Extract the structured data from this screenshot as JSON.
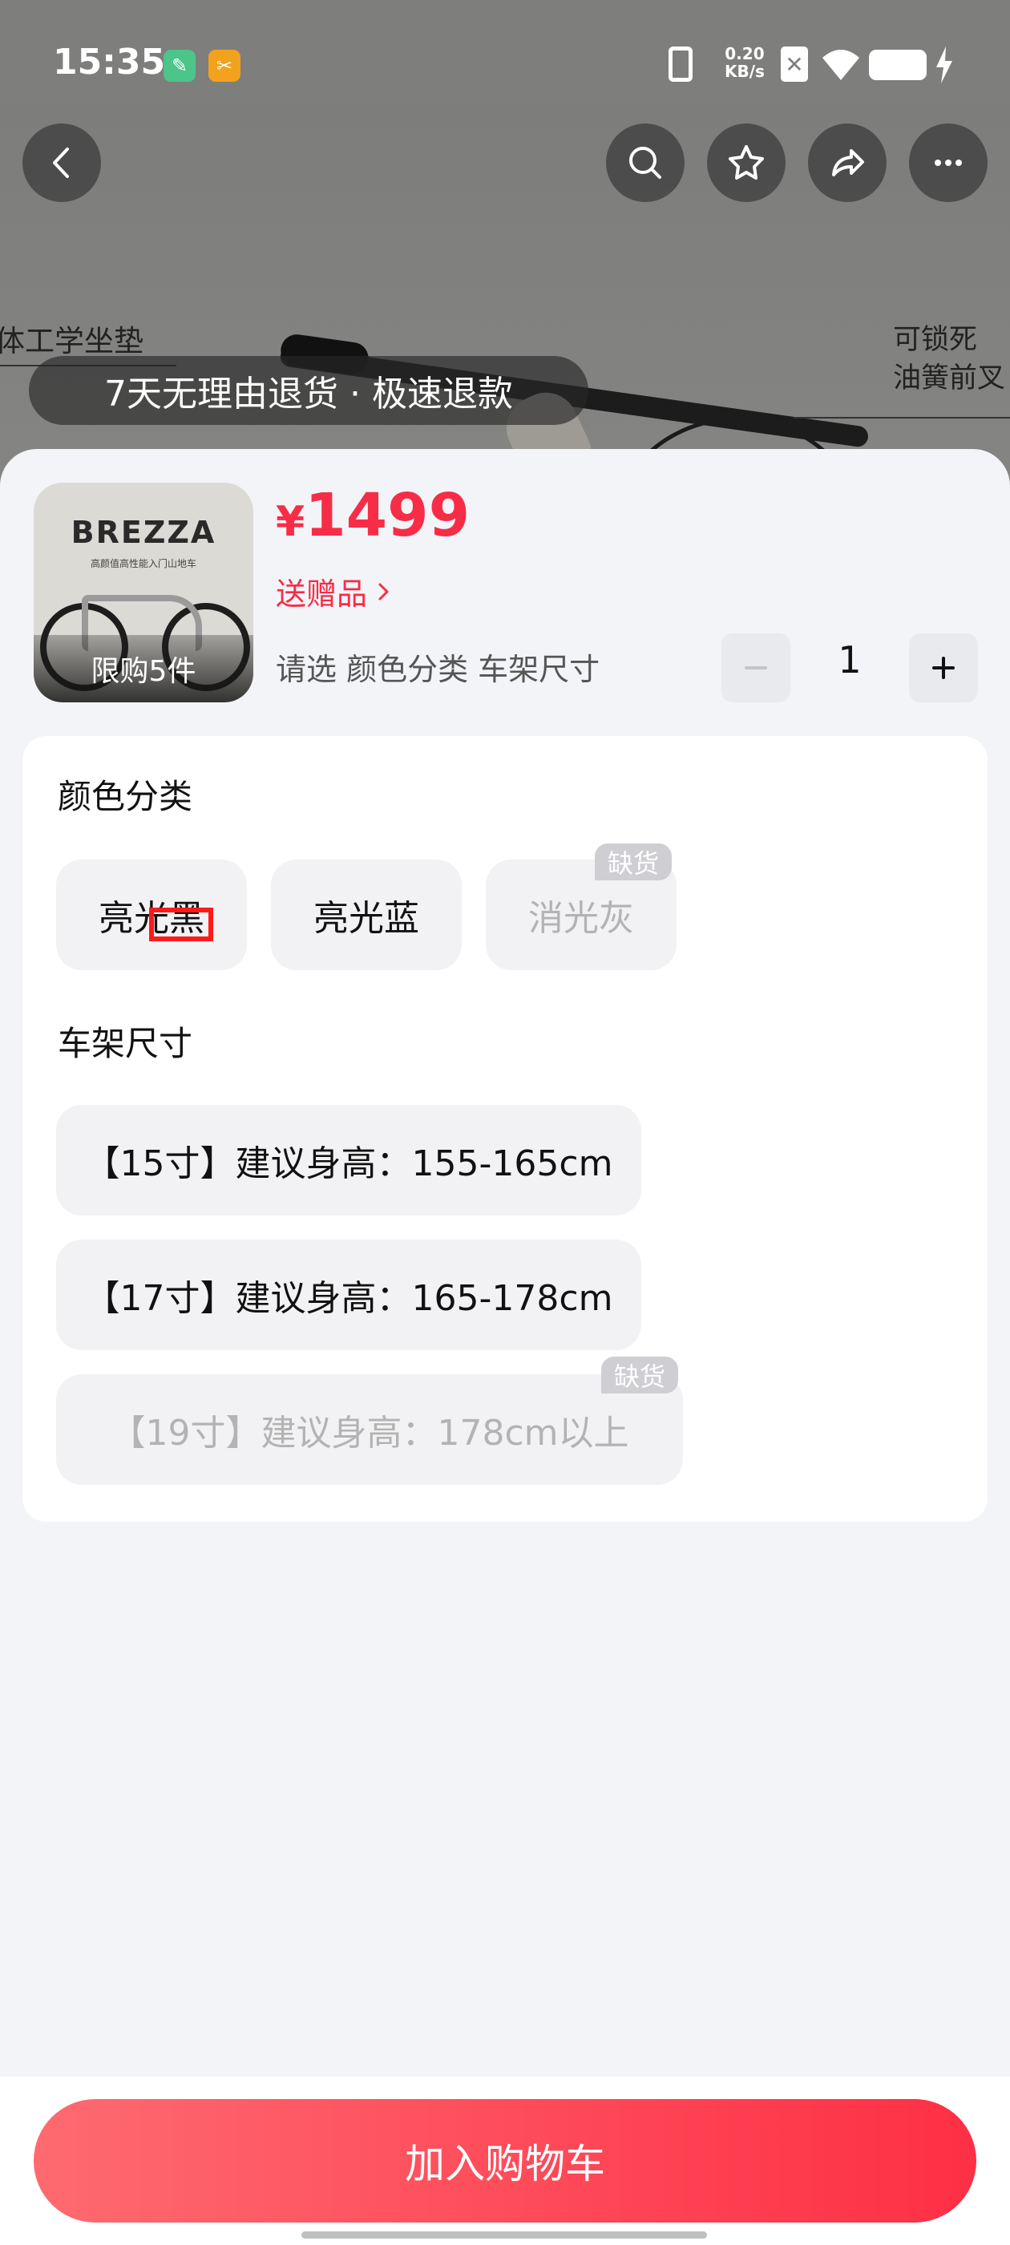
{
  "status_bar": {
    "time": "15:35",
    "net_speed_value": "0.20",
    "net_speed_unit": "KB/s"
  },
  "background": {
    "annotation_left": "体工学坐垫",
    "annotation_right_line1": "可锁死",
    "annotation_right_line2": "油簧前叉"
  },
  "banner": {
    "text": "7天无理由退货 · 极速退款"
  },
  "product": {
    "thumb_brand": "BREZZA",
    "thumb_tagline": "高颜值高性能入门山地车",
    "limit_label": "限购5件",
    "currency": "¥",
    "price": "1499",
    "gift_label": "送赠品",
    "choose_prompt": "请选 颜色分类 车架尺寸",
    "quantity": "1"
  },
  "color_section": {
    "title": "颜色分类",
    "options": [
      {
        "label": "亮光黑",
        "available": true
      },
      {
        "label": "亮光蓝",
        "available": true
      },
      {
        "label": "消光灰",
        "available": false
      }
    ]
  },
  "size_section": {
    "title": "车架尺寸",
    "options": [
      {
        "label": "【15寸】建议身高：155-165cm",
        "available": true
      },
      {
        "label": "【17寸】建议身高：165-178cm",
        "available": true
      },
      {
        "label": "【19寸】建议身高：178cm以上",
        "available": false
      }
    ]
  },
  "out_of_stock_label": "缺货",
  "bottom": {
    "add_to_cart_label": "加入购物车"
  },
  "colors": {
    "accent": "#f72d48",
    "button_gradient_start": "#fe6a70",
    "button_gradient_end": "#fe2f45",
    "highlight_box": "#ff1a1a"
  }
}
